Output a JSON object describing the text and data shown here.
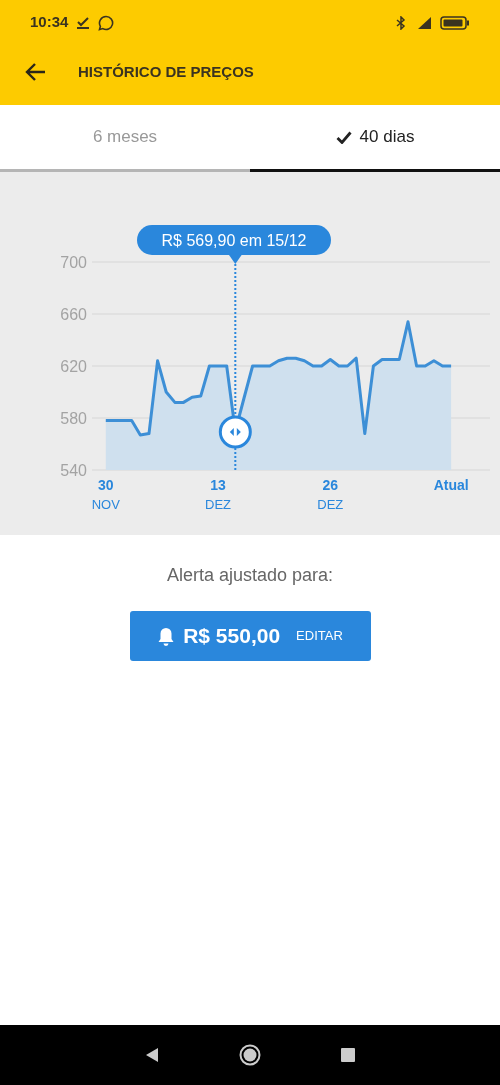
{
  "status_bar": {
    "time": "10:34"
  },
  "app_bar": {
    "title": "HISTÓRICO DE PREÇOS"
  },
  "tabs": [
    {
      "label": "6 meses",
      "selected": false
    },
    {
      "label": "40 dias",
      "selected": true
    }
  ],
  "chart": {
    "chart_data": {
      "type": "area",
      "x": [
        0,
        1,
        2,
        3,
        4,
        5,
        6,
        7,
        8,
        9,
        10,
        11,
        12,
        13,
        14,
        15,
        16,
        17,
        18,
        19,
        20,
        21,
        22,
        23,
        24,
        25,
        26,
        27,
        28,
        29,
        30,
        31,
        32,
        33,
        34,
        35,
        36,
        37,
        38,
        39,
        40
      ],
      "values": [
        578,
        578,
        578,
        578,
        567,
        568,
        624,
        600,
        592,
        592,
        596,
        597,
        620,
        620,
        620,
        569.9,
        595,
        620,
        620,
        620,
        624,
        626,
        626,
        624,
        620,
        620,
        625,
        620,
        620,
        626,
        568,
        620,
        625,
        625,
        625,
        654,
        620,
        620,
        624,
        620,
        620
      ],
      "xlim": [
        -1.6,
        44.5
      ],
      "ylim": [
        540,
        700
      ],
      "grid": true,
      "yticks": [
        540,
        580,
        620,
        660,
        700
      ],
      "xticks": [
        {
          "value": 0,
          "label": "30 NOV"
        },
        {
          "value": 13,
          "label": "13 DEZ"
        },
        {
          "value": 26,
          "label": "26 DEZ"
        },
        {
          "value": 40,
          "label": "Atual"
        }
      ],
      "annotations": [
        {
          "x": 15,
          "text": "R$ 569,90 em 15/12"
        }
      ]
    }
  },
  "alert": {
    "label": "Alerta ajustado para:",
    "price": "R$ 550,00",
    "action": "EDITAR"
  }
}
